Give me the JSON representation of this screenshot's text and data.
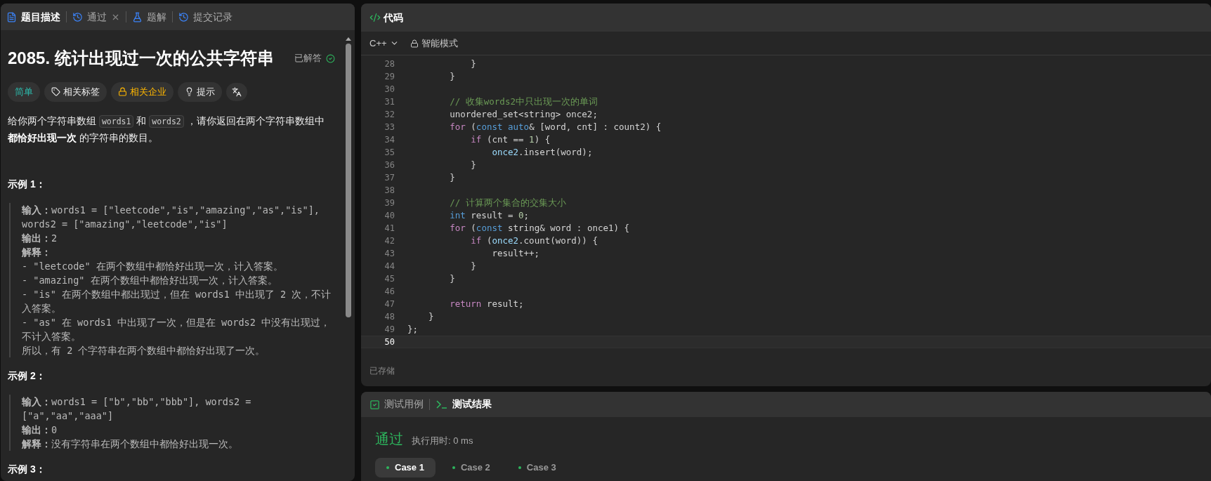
{
  "left_panel": {
    "tabs": [
      {
        "label": "题目描述",
        "selected": true,
        "closable": false
      },
      {
        "label": "通过",
        "selected": false,
        "closable": true
      },
      {
        "label": "题解",
        "selected": false,
        "closable": false
      },
      {
        "label": "提交记录",
        "selected": false,
        "closable": false
      }
    ],
    "problem": {
      "title": "2085. 统计出现过一次的公共字符串",
      "status": "已解答"
    },
    "tags": [
      {
        "kind": "difficulty",
        "label": "简单"
      },
      {
        "kind": "tag",
        "label": "相关标签"
      },
      {
        "kind": "premium",
        "label": "相关企业"
      },
      {
        "kind": "hint",
        "label": "提示"
      },
      {
        "kind": "font"
      }
    ],
    "description": [
      {
        "kind": "text",
        "text": "给你两个字符串数组 "
      },
      {
        "kind": "code",
        "text": "words1"
      },
      {
        "kind": "text",
        "text": " 和 "
      },
      {
        "kind": "code",
        "text": "words2"
      },
      {
        "kind": "text",
        "text": " ，请你返回在两个字符串数组中 "
      },
      {
        "kind": "bold",
        "text": "都恰好出现一次"
      },
      {
        "kind": "text",
        "text": " 的字符串的数目。"
      }
    ],
    "examples": [
      {
        "heading": "示例 1：",
        "lines": [
          "**输入：**words1 = [\"leetcode\",\"is\",\"amazing\",\"as\",\"is\"], words2 = [\"amazing\",\"leetcode\",\"is\"]",
          "**输出：**2",
          "**解释：**",
          "- \"leetcode\" 在两个数组中都恰好出现一次，计入答案。",
          "- \"amazing\" 在两个数组中都恰好出现一次，计入答案。",
          "- \"is\" 在两个数组中都出现过，但在 words1 中出现了 2 次，不计入答案。",
          "- \"as\" 在 words1 中出现了一次，但是在 words2 中没有出现过，不计入答案。",
          "所以，有 2 个字符串在两个数组中都恰好出现了一次。"
        ]
      },
      {
        "heading": "示例 2：",
        "lines": [
          "**输入：**words1 = [\"b\",\"bb\",\"bbb\"], words2 = [\"a\",\"aa\",\"aaa\"]",
          "**输出：**0",
          "**解释：**没有字符串在两个数组中都恰好出现一次。"
        ]
      },
      {
        "heading": "示例 3："
      }
    ]
  },
  "code_panel": {
    "title": "代码",
    "language": "C++",
    "mode": "智能模式",
    "status": "已存储",
    "lines": [
      {
        "number": "28",
        "current": false,
        "tokens": [
          {
            "kind": "plain",
            "text": "            }"
          }
        ]
      },
      {
        "number": "29",
        "current": false,
        "tokens": [
          {
            "kind": "plain",
            "text": "        }"
          }
        ]
      },
      {
        "number": "30",
        "current": false
      },
      {
        "number": "31",
        "current": false,
        "tokens": [
          {
            "kind": "comment",
            "text": "        // 收集words2中只出现一次的单词"
          }
        ]
      },
      {
        "number": "32",
        "current": false,
        "tokens": [
          {
            "kind": "plain",
            "text": "        unordered_set<string> once2;"
          }
        ]
      },
      {
        "number": "33",
        "current": false,
        "tokens": [
          {
            "kind": "control",
            "text": "        for"
          },
          {
            "kind": "plain",
            "text": " ("
          },
          {
            "kind": "type",
            "text": "const auto"
          },
          {
            "kind": "plain",
            "text": "& [word, cnt] : count2) {"
          }
        ]
      },
      {
        "number": "34",
        "current": false,
        "tokens": [
          {
            "kind": "control",
            "text": "            if"
          },
          {
            "kind": "plain",
            "text": " (cnt == "
          },
          {
            "kind": "number",
            "text": "1"
          },
          {
            "kind": "plain",
            "text": ") {"
          }
        ]
      },
      {
        "number": "35",
        "current": false,
        "tokens": [
          {
            "kind": "variable",
            "text": "                once2"
          },
          {
            "kind": "plain",
            "text": ".insert(word);"
          }
        ]
      },
      {
        "number": "36",
        "current": false,
        "tokens": [
          {
            "kind": "plain",
            "text": "            }"
          }
        ]
      },
      {
        "number": "37",
        "current": false,
        "tokens": [
          {
            "kind": "plain",
            "text": "        }"
          }
        ]
      },
      {
        "number": "38",
        "current": false
      },
      {
        "number": "39",
        "current": false,
        "tokens": [
          {
            "kind": "comment",
            "text": "        // 计算两个集合的交集大小"
          }
        ]
      },
      {
        "number": "40",
        "current": false,
        "tokens": [
          {
            "kind": "type",
            "text": "        int"
          },
          {
            "kind": "plain",
            "text": " result = "
          },
          {
            "kind": "number",
            "text": "0"
          },
          {
            "kind": "plain",
            "text": ";"
          }
        ]
      },
      {
        "number": "41",
        "current": false,
        "tokens": [
          {
            "kind": "control",
            "text": "        for"
          },
          {
            "kind": "plain",
            "text": " ("
          },
          {
            "kind": "type",
            "text": "const"
          },
          {
            "kind": "plain",
            "text": " string& word : once1) {"
          }
        ]
      },
      {
        "number": "42",
        "current": false,
        "tokens": [
          {
            "kind": "control",
            "text": "            if"
          },
          {
            "kind": "plain",
            "text": " ("
          },
          {
            "kind": "variable",
            "text": "once2"
          },
          {
            "kind": "plain",
            "text": ".count(word)) {"
          }
        ]
      },
      {
        "number": "43",
        "current": false,
        "tokens": [
          {
            "kind": "plain",
            "text": "                result++;"
          }
        ]
      },
      {
        "number": "44",
        "current": false,
        "tokens": [
          {
            "kind": "plain",
            "text": "            }"
          }
        ]
      },
      {
        "number": "45",
        "current": false,
        "tokens": [
          {
            "kind": "plain",
            "text": "        }"
          }
        ]
      },
      {
        "number": "46",
        "current": false
      },
      {
        "number": "47",
        "current": false,
        "tokens": [
          {
            "kind": "control",
            "text": "        return"
          },
          {
            "kind": "plain",
            "text": " result;"
          }
        ]
      },
      {
        "number": "48",
        "current": false,
        "tokens": [
          {
            "kind": "plain",
            "text": "    }"
          }
        ]
      },
      {
        "number": "49",
        "current": false,
        "tokens": [
          {
            "kind": "plain",
            "text": "};"
          }
        ]
      },
      {
        "number": "50",
        "current": true
      }
    ]
  },
  "result_panel": {
    "tabs": [
      {
        "label": "测试用例",
        "selected": false
      },
      {
        "label": "测试结果",
        "selected": true
      }
    ],
    "verdict": "通过",
    "runtime": "执行用时: 0 ms",
    "cases": [
      {
        "label": "Case 1",
        "selected": true,
        "passed": true
      },
      {
        "label": "Case 2",
        "selected": false,
        "passed": true
      },
      {
        "label": "Case 3",
        "selected": false,
        "passed": true
      }
    ]
  }
}
